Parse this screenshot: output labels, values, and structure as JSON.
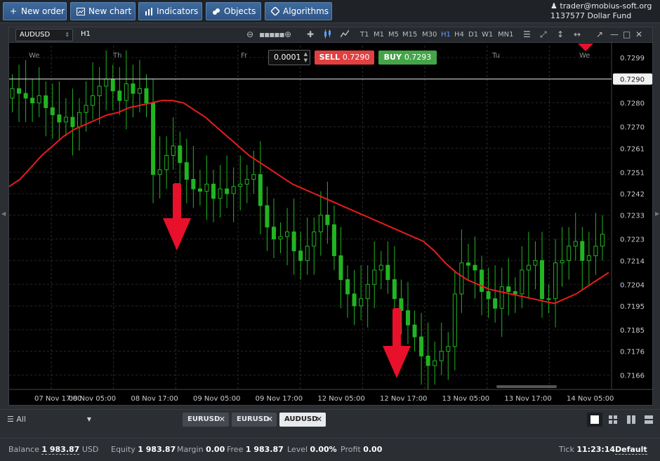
{
  "toolbar": {
    "new_order": "New order",
    "new_chart": "New chart",
    "indicators": "Indicators",
    "objects": "Objects",
    "algorithms": "Algorithms"
  },
  "account": {
    "user": "trader@mobius-soft.org",
    "fund": "1137577  Dollar Fund"
  },
  "chart": {
    "symbol": "AUDUSD",
    "timeframe": "H1",
    "timeframes": [
      "T1",
      "M1",
      "M5",
      "M15",
      "M30",
      "H1",
      "H4",
      "D1",
      "W1",
      "MN1"
    ],
    "active_timeframe": "H1",
    "lot": "0.0001",
    "sell_label": "SELL",
    "sell_price": "0.7290",
    "buy_label": "BUY",
    "buy_price": "0.7293",
    "current_price_label": "0.7290",
    "colors": {
      "bull": "#22b422",
      "ma": "#e81c1c",
      "arrow": "#e8102a",
      "sell": "#e04040",
      "buy": "#44a548"
    }
  },
  "chart_data": {
    "type": "candlestick",
    "symbol": "AUDUSD",
    "timeframe": "H1",
    "yticks": [
      0.7299,
      0.729,
      0.728,
      0.727,
      0.7261,
      0.7251,
      0.7242,
      0.7233,
      0.7223,
      0.7214,
      0.7204,
      0.7195,
      0.7185,
      0.7176,
      0.7166
    ],
    "ylim": [
      0.716,
      0.7304
    ],
    "current_price": 0.729,
    "xticks": [
      "07 Nov 17:00",
      "08 Nov 05:00",
      "08 Nov 17:00",
      "09 Nov 05:00",
      "09 Nov 17:00",
      "12 Nov 05:00",
      "12 Nov 17:00",
      "13 Nov 05:00",
      "13 Nov 17:00",
      "14 Nov 05:00"
    ],
    "day_labels": [
      "We",
      "Th",
      "Fr",
      "Tu",
      "We"
    ],
    "series": [
      {
        "name": "close",
        "values": [
          0.7286,
          0.7284,
          0.7282,
          0.728,
          0.7283,
          0.7278,
          0.7275,
          0.7272,
          0.7274,
          0.727,
          0.7276,
          0.7279,
          0.7283,
          0.7287,
          0.729,
          0.7285,
          0.7281,
          0.7288,
          0.7284,
          0.7286,
          0.728,
          0.725,
          0.7252,
          0.7258,
          0.7262,
          0.7255,
          0.7248,
          0.7244,
          0.7243,
          0.7246,
          0.724,
          0.7244,
          0.7242,
          0.7245,
          0.7246,
          0.7248,
          0.725,
          0.7237,
          0.7228,
          0.7223,
          0.7224,
          0.7226,
          0.7218,
          0.7214,
          0.722,
          0.7226,
          0.7233,
          0.7229,
          0.7216,
          0.7206,
          0.72,
          0.7195,
          0.7198,
          0.7204,
          0.721,
          0.7212,
          0.7206,
          0.7198,
          0.7193,
          0.7187,
          0.7182,
          0.7174,
          0.717,
          0.7172,
          0.7176,
          0.7178,
          0.72,
          0.7213,
          0.7212,
          0.721,
          0.7201,
          0.7198,
          0.7194,
          0.7203,
          0.7201,
          0.72,
          0.721,
          0.7212,
          0.7214,
          0.7198,
          0.7198,
          0.7213,
          0.7214,
          0.722,
          0.7222,
          0.7214,
          0.7216,
          0.722,
          0.7225
        ]
      },
      {
        "name": "moving-average",
        "values": [
          0.7245,
          0.7248,
          0.7253,
          0.7258,
          0.7262,
          0.7266,
          0.7269,
          0.7271,
          0.7273,
          0.7275,
          0.7276,
          0.7278,
          0.7279,
          0.728,
          0.7281,
          0.7281,
          0.728,
          0.7277,
          0.7274,
          0.727,
          0.7266,
          0.7262,
          0.7258,
          0.7255,
          0.7252,
          0.7249,
          0.7246,
          0.7244,
          0.7242,
          0.724,
          0.7238,
          0.7236,
          0.7234,
          0.7232,
          0.723,
          0.7228,
          0.7226,
          0.7224,
          0.7222,
          0.7218,
          0.7213,
          0.7209,
          0.7206,
          0.7204,
          0.7202,
          0.7201,
          0.72,
          0.7199,
          0.7198,
          0.7197,
          0.7196,
          0.7198,
          0.72,
          0.7203,
          0.7206,
          0.7209
        ]
      }
    ]
  },
  "tabs": {
    "filter": "All",
    "items": [
      "EURUSD",
      "EURUSD",
      "AUDUSD"
    ],
    "active": "AUDUSD"
  },
  "status": {
    "balance_label": "Balance",
    "balance_value": "1 983.87",
    "balance_ccy": "USD",
    "equity_label": "Equity",
    "equity_value": "1 983.87",
    "margin_label": "Margin",
    "margin_value": "0.00",
    "free_label": "Free",
    "free_value": "1 983.87",
    "level_label": "Level",
    "level_value": "0.00%",
    "profit_label": "Profit",
    "profit_value": "0.00",
    "tick_label": "Tick",
    "tick_value": "11:23:14",
    "default_label": "Default"
  }
}
